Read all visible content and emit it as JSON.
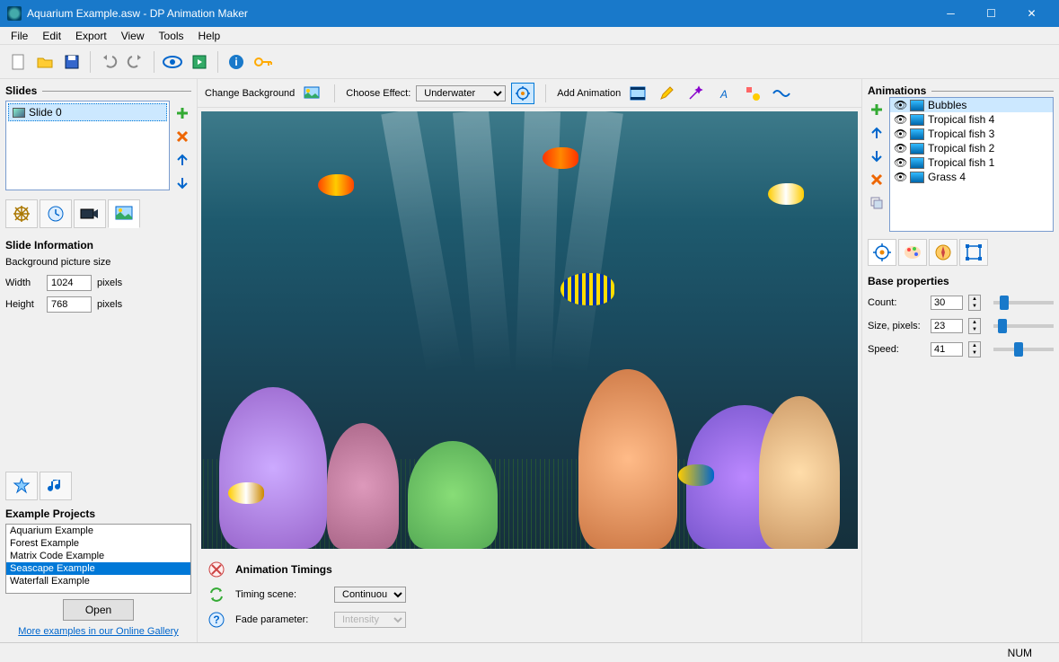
{
  "titlebar": {
    "title": "Aquarium Example.asw - DP Animation Maker"
  },
  "menu": [
    "File",
    "Edit",
    "Export",
    "View",
    "Tools",
    "Help"
  ],
  "slides": {
    "header": "Slides",
    "items": [
      "Slide 0"
    ]
  },
  "slideInfo": {
    "title": "Slide Information",
    "subtitle": "Background picture size",
    "widthLabel": "Width",
    "widthValue": "1024",
    "heightLabel": "Height",
    "heightValue": "768",
    "unit": "pixels"
  },
  "examples": {
    "title": "Example Projects",
    "items": [
      "Aquarium Example",
      "Forest Example",
      "Matrix Code Example",
      "Seascape Example",
      "Waterfall Example"
    ],
    "selectedIndex": 3,
    "openLabel": "Open",
    "link": "More examples in our Online Gallery"
  },
  "centerToolbar": {
    "changeBg": "Change Background",
    "chooseEffect": "Choose Effect:",
    "effectValue": "Underwater",
    "addAnim": "Add Animation"
  },
  "timings": {
    "title": "Animation Timings",
    "timingScene": "Timing scene:",
    "timingValue": "Continuous",
    "fadeParam": "Fade parameter:",
    "fadeValue": "Intensity"
  },
  "animations": {
    "header": "Animations",
    "items": [
      "Bubbles",
      "Tropical fish 4",
      "Tropical fish 3",
      "Tropical fish 2",
      "Tropical fish 1",
      "Grass 4"
    ],
    "selectedIndex": 0
  },
  "props": {
    "title": "Base properties",
    "count": {
      "label": "Count:",
      "value": "30",
      "pos": 10
    },
    "size": {
      "label": "Size, pixels:",
      "value": "23",
      "pos": 8
    },
    "speed": {
      "label": "Speed:",
      "value": "41",
      "pos": 35
    }
  },
  "statusbar": {
    "num": "NUM"
  }
}
